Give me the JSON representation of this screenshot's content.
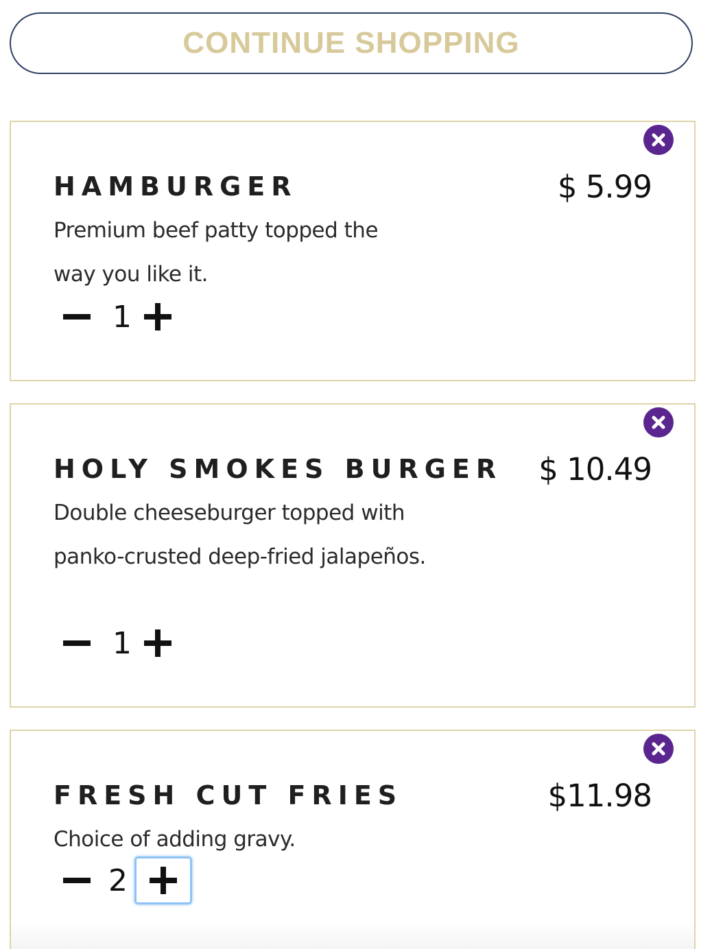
{
  "continue_button": {
    "label": "CONTINUE SHOPPING"
  },
  "cart": {
    "items": [
      {
        "name": "HAMBURGER",
        "price": "$ 5.99",
        "description": "Premium beef patty topped the way you like it.",
        "quantity": "1"
      },
      {
        "name": "HOLY SMOKES BURGER",
        "price": "$ 10.49",
        "description": "Double cheeseburger topped with panko-crusted deep-fried jalapeños.",
        "quantity": "1"
      },
      {
        "name": "FRESH CUT FRIES",
        "price": "$11.98",
        "description": "Choice of adding gravy.",
        "quantity": "2"
      }
    ]
  },
  "icons": {
    "remove": "close-circle-icon",
    "decrement": "minus-icon",
    "increment": "plus-icon"
  },
  "colors": {
    "accent_gold": "#d7c99a",
    "card_border": "#ded4a8",
    "button_border": "#2f3f62",
    "remove_purple": "#5b2590",
    "focus_ring": "#8ec2f5"
  }
}
